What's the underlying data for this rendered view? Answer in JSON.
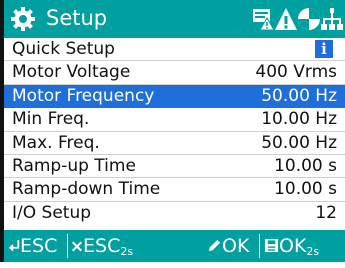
{
  "header": {
    "title": "Setup",
    "icons": [
      "gear-icon",
      "battery-warning-icon",
      "alert-triangle-icon",
      "status-circle-icon",
      "network-icon"
    ]
  },
  "menu": {
    "section_title": "Quick Setup",
    "items": [
      {
        "label": "Motor Voltage",
        "value": "400 Vrms"
      },
      {
        "label": "Motor Frequency",
        "value": "50.00 Hz",
        "selected": true
      },
      {
        "label": "Min Freq.",
        "value": "10.00 Hz"
      },
      {
        "label": "Max. Freq.",
        "value": "50.00 Hz"
      },
      {
        "label": "Ramp-up Time",
        "value": "10.00 s"
      },
      {
        "label": "Ramp-down Time",
        "value": "10.00 s"
      },
      {
        "label": "I/O Setup",
        "value": "12"
      }
    ]
  },
  "footer": {
    "back": {
      "icon": "back-arrow-icon",
      "label": "ESC"
    },
    "cancel": {
      "icon": "close-icon",
      "label": "ESC",
      "sub": "2s"
    },
    "edit": {
      "icon": "pencil-icon",
      "label": "OK"
    },
    "save": {
      "icon": "save-icon",
      "label": "OK",
      "sub": "2s"
    }
  },
  "colors": {
    "accent": "#00a0a0",
    "selection": "#1e6fd9"
  }
}
